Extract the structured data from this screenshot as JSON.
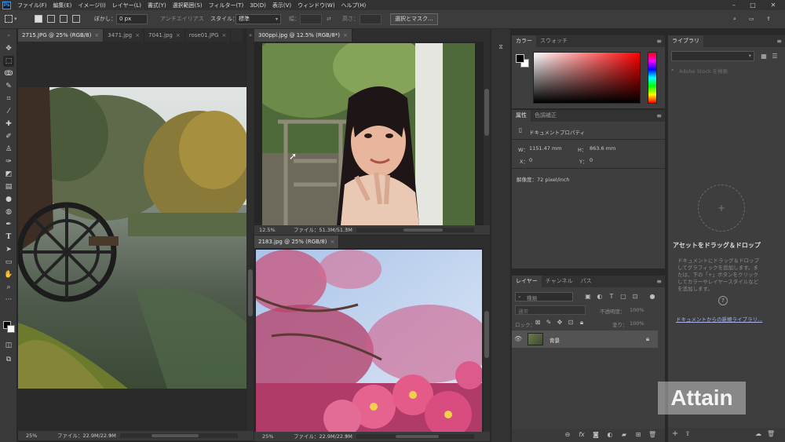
{
  "app": {
    "logo": "Ps"
  },
  "menubar": {
    "items": [
      "ファイル(F)",
      "編集(E)",
      "イメージ(I)",
      "レイヤー(L)",
      "書式(Y)",
      "選択範囲(S)",
      "フィルター(T)",
      "3D(D)",
      "表示(V)",
      "ウィンドウ(W)",
      "ヘルプ(H)"
    ],
    "minimize": "–",
    "maximize": "□",
    "close": "✕"
  },
  "options": {
    "feather_label": "ぼかし：",
    "feather_value": "0 px",
    "antialias_label": "アンチエイリアス",
    "style_label": "スタイル：",
    "style_value": "標準",
    "width_label": "幅：",
    "height_label": "高さ：",
    "select_mask_button": "選択とマスク..."
  },
  "left_doc": {
    "tabs": [
      {
        "label": "2715.JPG @ 25% (RGB/8)",
        "active": true
      },
      {
        "label": "3471.jpg",
        "active": false
      },
      {
        "label": "7041.jpg",
        "active": false
      },
      {
        "label": "rose01.JPG",
        "active": false
      }
    ],
    "tab_close": "×",
    "overflow": "»",
    "zoom": "25%",
    "file_info": "ファイル：22.9M/22.9M"
  },
  "right_top_doc": {
    "tab_label": "300ppi.jpg @ 12.5% (RGB/8*)",
    "zoom": "12.5%",
    "file_info": "ファイル：51.3M/51.3M"
  },
  "right_bottom_doc": {
    "tab_label": "2183.jpg @ 25% (RGB/8)",
    "zoom": "25%",
    "file_info": "ファイル：22.9M/22.9M"
  },
  "color_panel": {
    "tabs": [
      "カラー",
      "スウォッチ"
    ],
    "fg_color": "#000000",
    "bg_color": "#ffffff",
    "hue_color": "#ff0000"
  },
  "properties_panel": {
    "tabs": [
      "属性",
      "色調補正"
    ],
    "section": "ドキュメントプロパティ",
    "w_label": "W：",
    "w_value": "1151.47 mm",
    "h_label": "H：",
    "h_value": "863.6 mm",
    "x_label": "X：",
    "x_value": "0",
    "y_label": "Y：",
    "y_value": "0",
    "resolution": "解像度：72 pixel/inch"
  },
  "layers_panel": {
    "tabs": [
      "レイヤー",
      "チャンネル",
      "パス"
    ],
    "filter_placeholder": "種類",
    "blend_mode": "通常",
    "opacity_label": "不透明度：",
    "opacity_value": "100%",
    "lock_label": "ロック：",
    "fill_label": "塗り：",
    "fill_value": "100%",
    "layer_name": "背景"
  },
  "library_panel": {
    "tab": "ライブラリ",
    "search_placeholder": "Adobe Stock を検索",
    "drop_title": "アセットをドラッグ＆ドロップ",
    "drop_text_1": "ドキュメントにドラッグ＆ドロップ",
    "drop_text_2": "してグラフィックを追加します。ま",
    "drop_text_3": "たは、下の「+」ボタンをクリック",
    "drop_text_4": "してカラーやレイヤースタイルなど",
    "drop_text_5": "を追加します。",
    "link": "ドキュメントからの新規ライブラリ..."
  },
  "watermark": {
    "text": "Attain"
  },
  "colors": {
    "accent": "#31a8ff",
    "panel_bg": "#3e3e3e",
    "workspace": "#282828"
  }
}
